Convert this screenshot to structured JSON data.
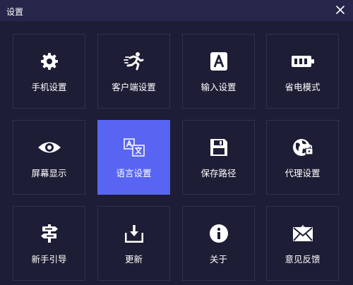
{
  "window": {
    "title": "设置"
  },
  "tiles": [
    {
      "label": "手机设置",
      "icon": "gear-icon"
    },
    {
      "label": "客户端设置",
      "icon": "running-person-icon"
    },
    {
      "label": "输入设置",
      "icon": "letter-a-icon"
    },
    {
      "label": "省电模式",
      "icon": "battery-icon"
    },
    {
      "label": "屏幕显示",
      "icon": "eye-icon"
    },
    {
      "label": "语言设置",
      "icon": "translate-icon",
      "selected": true
    },
    {
      "label": "保存路径",
      "icon": "floppy-disk-icon"
    },
    {
      "label": "代理设置",
      "icon": "globe-lock-icon"
    },
    {
      "label": "新手引导",
      "icon": "signpost-icon"
    },
    {
      "label": "更新",
      "icon": "download-tray-icon"
    },
    {
      "label": "关于",
      "icon": "info-icon"
    },
    {
      "label": "意见反馈",
      "icon": "feedback-envelope-icon"
    }
  ],
  "colors": {
    "background": "#1d1d35",
    "titlebar": "#26264a",
    "accent": "#5865f2",
    "tile_border": "#2f3150"
  }
}
